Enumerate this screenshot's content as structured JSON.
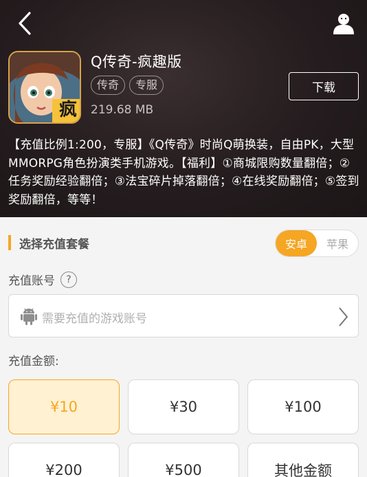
{
  "header": {
    "back_icon": "chevron-left-icon",
    "user_icon": "user-avatar-icon"
  },
  "game": {
    "title": "Q传奇-疯趣版",
    "tags": [
      "传奇",
      "专服"
    ],
    "size": "219.68 MB",
    "icon_badge": "疯",
    "download_label": "下载",
    "description": "【充值比例1:200，专服】《Q传奇》时尚Q萌换装，自由PK，大型MMORPG角色扮演类手机游戏。【福利】①商城限购数量翻倍；②任务奖励经验翻倍；③法宝碎片掉落翻倍；④在线奖励翻倍；⑤签到奖励翻倍，等等！"
  },
  "recharge": {
    "section_title": "选择充值套餐",
    "platforms": [
      {
        "label": "安卓",
        "active": true
      },
      {
        "label": "苹果",
        "active": false
      }
    ],
    "account_label": "充值账号",
    "help_symbol": "?",
    "account_placeholder": "需要充值的游戏账号",
    "amount_label": "充值金额:",
    "amounts": [
      {
        "label": "¥10",
        "selected": true
      },
      {
        "label": "¥30",
        "selected": false
      },
      {
        "label": "¥100",
        "selected": false
      },
      {
        "label": "¥200",
        "selected": false
      },
      {
        "label": "¥500",
        "selected": false
      },
      {
        "label": "其他金额",
        "selected": false
      }
    ]
  },
  "colors": {
    "accent": "#f5a623",
    "hero_bg": "#241c1e",
    "selected_bg": "#fff1d2"
  }
}
